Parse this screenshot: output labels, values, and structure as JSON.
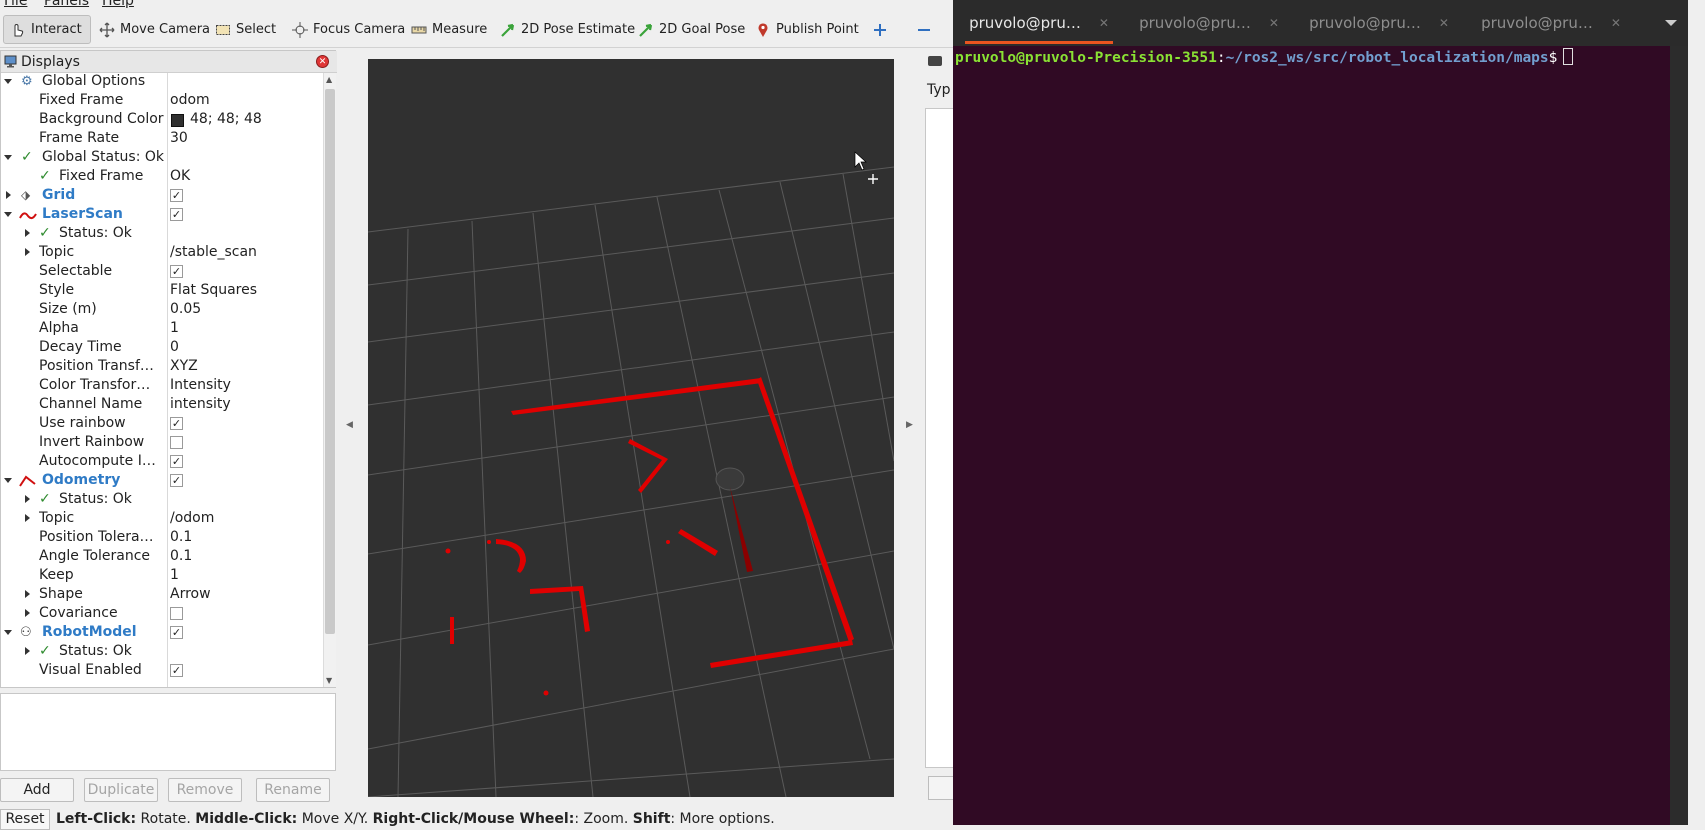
{
  "menubar": {
    "file": "File",
    "panels": "Panels",
    "help": "Help"
  },
  "toolbar": {
    "interact": "Interact",
    "move_camera": "Move Camera",
    "select": "Select",
    "focus_camera": "Focus Camera",
    "measure": "Measure",
    "pose_estimate": "2D Pose Estimate",
    "goal_pose": "2D Goal Pose",
    "publish_point": "Publish Point"
  },
  "displays": {
    "title": "Displays",
    "rows": [
      {
        "label": "Global Options",
        "value": ""
      },
      {
        "label": "Fixed Frame",
        "value": "odom"
      },
      {
        "label": "Background Color",
        "value": "48; 48; 48"
      },
      {
        "label": "Frame Rate",
        "value": "30"
      },
      {
        "label": "Global Status: Ok",
        "value": ""
      },
      {
        "label": "Fixed Frame",
        "value": "OK"
      },
      {
        "label": "Grid",
        "value": ""
      },
      {
        "label": "LaserScan",
        "value": ""
      },
      {
        "label": "Status: Ok",
        "value": ""
      },
      {
        "label": "Topic",
        "value": "/stable_scan"
      },
      {
        "label": "Selectable",
        "value": ""
      },
      {
        "label": "Style",
        "value": "Flat Squares"
      },
      {
        "label": "Size (m)",
        "value": "0.05"
      },
      {
        "label": "Alpha",
        "value": "1"
      },
      {
        "label": "Decay Time",
        "value": "0"
      },
      {
        "label": "Position Transf…",
        "value": "XYZ"
      },
      {
        "label": "Color Transfor…",
        "value": "Intensity"
      },
      {
        "label": "Channel Name",
        "value": "intensity"
      },
      {
        "label": "Use rainbow",
        "value": ""
      },
      {
        "label": "Invert Rainbow",
        "value": ""
      },
      {
        "label": "Autocompute I…",
        "value": ""
      },
      {
        "label": "Odometry",
        "value": ""
      },
      {
        "label": "Status: Ok",
        "value": ""
      },
      {
        "label": "Topic",
        "value": "/odom"
      },
      {
        "label": "Position Tolera…",
        "value": "0.1"
      },
      {
        "label": "Angle Tolerance",
        "value": "0.1"
      },
      {
        "label": "Keep",
        "value": "1"
      },
      {
        "label": "Shape",
        "value": "Arrow"
      },
      {
        "label": "Covariance",
        "value": ""
      },
      {
        "label": "RobotModel",
        "value": ""
      },
      {
        "label": "Status: Ok",
        "value": ""
      },
      {
        "label": "Visual Enabled",
        "value": ""
      }
    ],
    "checked": {
      "grid": true,
      "laserscan": true,
      "selectable": true,
      "use_rainbow": true,
      "invert_rainbow": false,
      "autocompute": true,
      "odometry": true,
      "covariance": false,
      "robotmodel": true,
      "visual_enabled": true
    }
  },
  "buttons": {
    "add": "Add",
    "duplicate": "Duplicate",
    "remove": "Remove",
    "rename": "Rename"
  },
  "status": {
    "reset": "Reset",
    "b1": "Left-Click:",
    "t1": " Rotate. ",
    "b2": "Middle-Click:",
    "t2": " Move X/Y. ",
    "b3": "Right-Click/Mouse Wheel:",
    "t3": ": Zoom. ",
    "b4": "Shift",
    "t4": ": More options."
  },
  "right_panel": {
    "type_label": "Typ"
  },
  "terminal": {
    "tabs": [
      "pruvolo@pru…",
      "pruvolo@pru…",
      "pruvolo@pru…",
      "pruvolo@pru…"
    ],
    "prompt_user": "pruvolo@pruvolo-Precision-3551",
    "prompt_sep": ":",
    "prompt_path": "~/ros2_ws/src/robot_localization/maps",
    "prompt_symbol": "$"
  },
  "colors": {
    "laser_points": "#e00000",
    "background": "#303030",
    "terminal_bg": "#300a24",
    "tab_accent": "#e95420"
  }
}
